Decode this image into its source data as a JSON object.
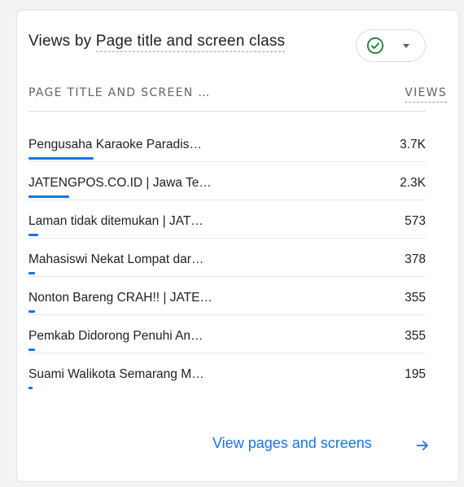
{
  "card": {
    "title_prefix": "Views by ",
    "title_dim": "Page title and screen class",
    "compare_icon": "check-circle-icon",
    "compare_caret_icon": "caret-down-icon"
  },
  "table": {
    "col_left": "PAGE TITLE AND SCREEN …",
    "col_right": "VIEWS",
    "max_views": 3700,
    "rows": [
      {
        "label": "Pengusaha Karaoke Paradis…",
        "value": "3.7K",
        "views": 3700
      },
      {
        "label": "JATENGPOS.CO.ID | Jawa Te…",
        "value": "2.3K",
        "views": 2300
      },
      {
        "label": "Laman tidak ditemukan | JAT…",
        "value": "573",
        "views": 573
      },
      {
        "label": "Mahasiswi Nekat Lompat dar…",
        "value": "378",
        "views": 378
      },
      {
        "label": "Nonton Bareng CRAH!! | JATE…",
        "value": "355",
        "views": 355
      },
      {
        "label": "Pemkab Didorong Penuhi An…",
        "value": "355",
        "views": 355
      },
      {
        "label": "Suami Walikota Semarang M…",
        "value": "195",
        "views": 195
      }
    ]
  },
  "footer": {
    "link_label": "View pages and screens",
    "arrow_icon": "arrow-right-icon"
  },
  "colors": {
    "accent": "#1a73e8",
    "check_green": "#188038"
  }
}
